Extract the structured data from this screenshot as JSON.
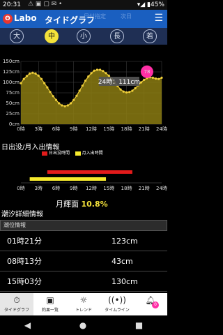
{
  "status_bar": {
    "time": "20:31",
    "battery": "45%"
  },
  "app_bar": {
    "logo_text": "Labo",
    "title": "タイドグラフ",
    "hint_left": "日付指定",
    "hint_right": "次日"
  },
  "moon_phases": [
    "大",
    "中",
    "小",
    "長",
    "若"
  ],
  "selected_moon": "中",
  "tide_section": {
    "tooltip": "24時：111cm",
    "pin_label": "78"
  },
  "chart_data": {
    "type": "area",
    "title": "",
    "xlabel": "",
    "ylabel": "",
    "x_ticks": [
      "0時",
      "3時",
      "6時",
      "9時",
      "12時",
      "15時",
      "18時",
      "21時",
      "24時"
    ],
    "y_ticks": [
      "0cm",
      "25cm",
      "50cm",
      "75cm",
      "100cm",
      "125cm",
      "150cm"
    ],
    "ylim": [
      0,
      150
    ],
    "xlim": [
      0,
      24
    ],
    "series": [
      {
        "x": [
          0,
          0.5,
          1,
          1.5,
          2,
          2.5,
          3,
          3.5,
          4,
          4.5,
          5,
          5.5,
          6,
          6.5,
          7,
          7.5,
          8,
          8.5,
          9,
          9.5,
          10,
          10.5,
          11,
          11.5,
          12,
          12.5,
          13,
          13.5,
          14,
          14.5,
          15,
          15.5,
          16,
          16.5,
          17,
          17.5,
          18,
          18.5,
          19,
          19.5,
          20,
          20.5,
          21,
          21.5,
          22,
          22.5,
          23,
          23.5,
          24
        ],
        "y": [
          98,
          108,
          115,
          121,
          123,
          121,
          116,
          108,
          98,
          88,
          77,
          67,
          58,
          50,
          45,
          43,
          45,
          50,
          58,
          68,
          80,
          92,
          104,
          114,
          122,
          128,
          130,
          130,
          127,
          122,
          116,
          108,
          100,
          91,
          83,
          78,
          76,
          77,
          80,
          86,
          93,
          100,
          106,
          110,
          112,
          111,
          109,
          108,
          111
        ]
      }
    ],
    "colors": {
      "fill": "#8b7b12",
      "line": "#f0cf3a",
      "point": "#f0cf3a"
    },
    "grid": true
  },
  "sun_moon_section": {
    "title": "日出没/月入出情報",
    "legend_sun": "日出没時間",
    "legend_moon": "月入出時間",
    "x_ticks": [
      "0時",
      "3時",
      "6時",
      "9時",
      "12時",
      "15時",
      "18時",
      "21時",
      "24時"
    ],
    "sun_bar": {
      "start": 4.5,
      "end": 19.0
    },
    "moon_bar": {
      "start": 1.5,
      "end": 14.5
    },
    "colors": {
      "sun": "#e31b1b",
      "moon": "#f6ea2d"
    }
  },
  "moon_age": {
    "label": "月輝面",
    "value": "10.8%"
  },
  "tide_detail": {
    "title": "潮汐詳細情報",
    "subheader": "潮位情報",
    "rows": [
      {
        "time": "01時21分",
        "level": "123cm"
      },
      {
        "time": "08時13分",
        "level": "43cm"
      },
      {
        "time": "15時03分",
        "level": "130cm"
      }
    ]
  },
  "bottom_nav": [
    {
      "label": "タイドグラフ",
      "icon": "tide-icon",
      "active": true
    },
    {
      "label": "釣果一覧",
      "icon": "gallery-icon",
      "active": false
    },
    {
      "label": "トレンド",
      "icon": "bulb-icon",
      "active": false
    },
    {
      "label": "タイムライン",
      "icon": "signal-icon",
      "active": false
    },
    {
      "label": "",
      "icon": "bell-icon",
      "active": false,
      "badge": "0"
    }
  ]
}
